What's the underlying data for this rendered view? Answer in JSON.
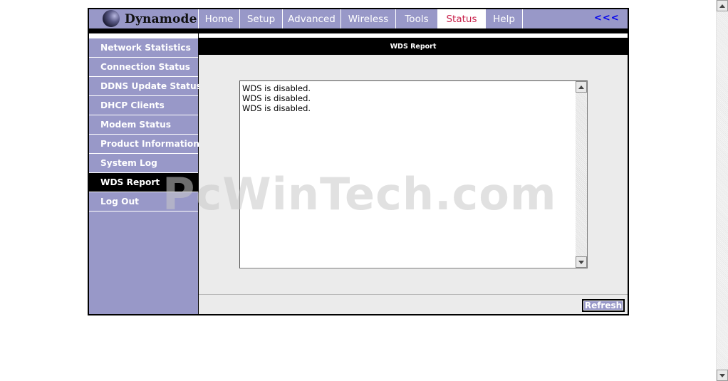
{
  "brand": {
    "name": "Dynamode"
  },
  "nav": {
    "items": [
      {
        "label": "Home",
        "active": false
      },
      {
        "label": "Setup",
        "active": false
      },
      {
        "label": "Advanced",
        "active": false
      },
      {
        "label": "Wireless",
        "active": false
      },
      {
        "label": "Tools",
        "active": false
      },
      {
        "label": "Status",
        "active": true
      },
      {
        "label": "Help",
        "active": false
      }
    ],
    "back_label": "<<<"
  },
  "sidebar": {
    "items": [
      {
        "label": "Network Statistics",
        "active": false
      },
      {
        "label": "Connection Status",
        "active": false
      },
      {
        "label": "DDNS Update Status",
        "active": false
      },
      {
        "label": "DHCP Clients",
        "active": false
      },
      {
        "label": "Modem Status",
        "active": false
      },
      {
        "label": "Product Information",
        "active": false
      },
      {
        "label": "System Log",
        "active": false
      },
      {
        "label": "WDS Report",
        "active": true
      },
      {
        "label": "Log Out",
        "active": false
      }
    ]
  },
  "main": {
    "title": "WDS Report",
    "report_lines": [
      "WDS is disabled.",
      "WDS is disabled.",
      "WDS is disabled."
    ],
    "refresh_label": "Refresh"
  },
  "watermark": "PcWinTech.com",
  "colors": {
    "nav_bg": "#9898c8",
    "active_tab_text": "#c8204a",
    "active_side_bg": "#000000",
    "content_bg": "#ebebeb",
    "back_link": "#0000ee"
  },
  "icons": {
    "scroll_up": "triangle-up-icon",
    "scroll_down": "triangle-down-icon",
    "logo": "sphere-logo-icon"
  }
}
